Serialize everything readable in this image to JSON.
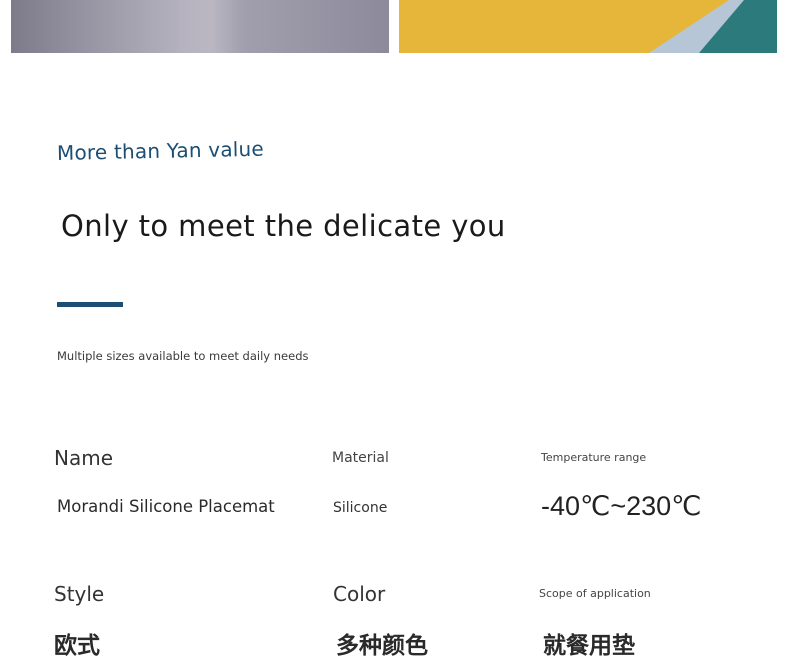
{
  "intro": {
    "eyebrow": "More than Yan value",
    "headline": "Only to meet the delicate you",
    "subtext": "Multiple sizes available to meet daily needs"
  },
  "specs": {
    "name_label": "Name",
    "name_value": "Morandi Silicone Placemat",
    "material_label": "Material",
    "material_value": "Silicone",
    "temperature_label": "Temperature range",
    "temperature_value": "-40℃~230℃",
    "style_label": "Style",
    "style_value": "欧式",
    "color_label": "Color",
    "color_value": "多种颜色",
    "scope_label": "Scope of application",
    "scope_value": "就餐用垫"
  },
  "colors": {
    "accent": "#1c4e73",
    "photo_left": "#a6a3b1",
    "photo_right_yellow": "#e5b63a",
    "photo_right_blue": "#b6c6d6",
    "photo_right_teal": "#2d7a7c"
  }
}
